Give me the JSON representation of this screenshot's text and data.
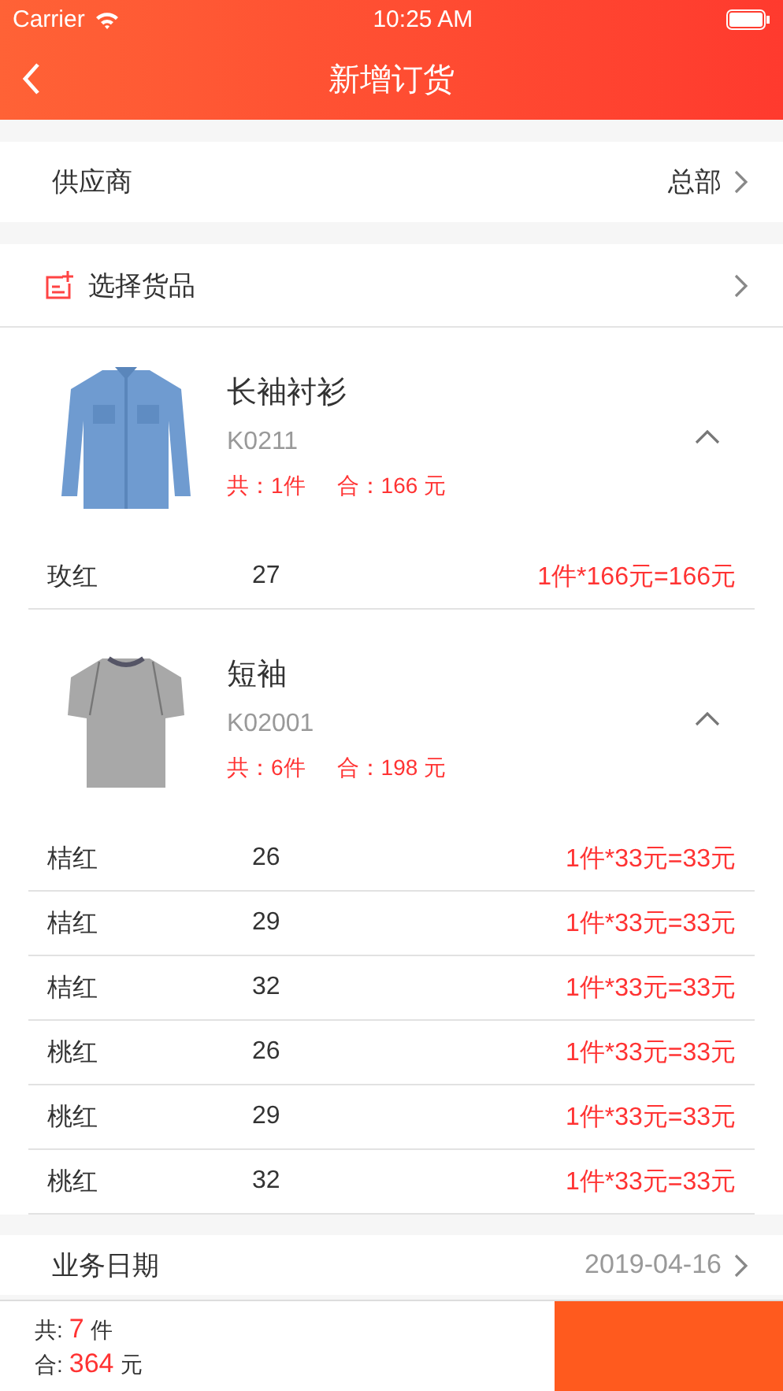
{
  "status_bar": {
    "carrier": "Carrier",
    "time": "10:25 AM"
  },
  "nav": {
    "title": "新增订货"
  },
  "supplier": {
    "label": "供应商",
    "value": "总部"
  },
  "select_goods": {
    "label": "选择货品"
  },
  "products": [
    {
      "name": "长袖衬衫",
      "code": "K0211",
      "count": "共：1件",
      "total": "合：166 元",
      "expanded": true,
      "picture": {
        "kind": "picture"
      },
      "rows": [
        {
          "variant": "玫红",
          "size": "27",
          "price": "1件*166元=166元"
        }
      ]
    },
    {
      "name": "短袖",
      "code": "K02001",
      "count": "共：6件",
      "total": "合：198 元",
      "expanded": true,
      "picture": {
        "kind": "picture"
      },
      "rows": [
        {
          "variant": "桔红",
          "size": "26",
          "price": "1件*33元=33元"
        },
        {
          "variant": "桔红",
          "size": "29",
          "price": "1件*33元=33元"
        },
        {
          "variant": "桔红",
          "size": "32",
          "price": "1件*33元=33元"
        },
        {
          "variant": "桃红",
          "size": "26",
          "price": "1件*33元=33元"
        },
        {
          "variant": "桃红",
          "size": "29",
          "price": "1件*33元=33元"
        },
        {
          "variant": "桃红",
          "size": "32",
          "price": "1件*33元=33元"
        }
      ]
    }
  ],
  "date": {
    "label": "业务日期",
    "value": "2019-04-16"
  },
  "footer": {
    "count": {
      "label": "共:",
      "value": "7",
      "unit": "件"
    },
    "total": {
      "label": "合:",
      "value": "364",
      "unit": "元"
    }
  }
}
